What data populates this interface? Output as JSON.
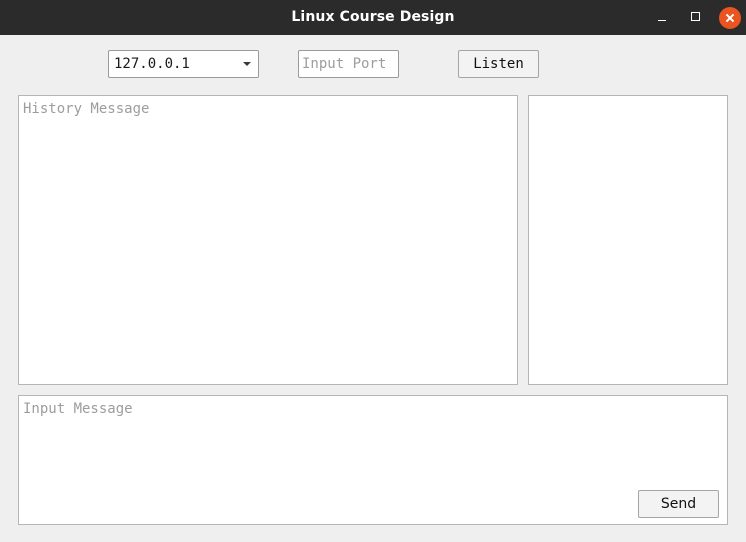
{
  "window": {
    "title": "Linux Course Design",
    "controls": {
      "minimize_icon": "minimize-icon",
      "maximize_icon": "maximize-icon",
      "close_icon": "close-icon",
      "close_color": "#e95420"
    }
  },
  "toolbar": {
    "ip_select": {
      "value": "127.0.0.1"
    },
    "port_input": {
      "value": "",
      "placeholder": "Input Port"
    },
    "listen_label": "Listen"
  },
  "history": {
    "value": "",
    "placeholder": "History Message"
  },
  "clients": {
    "items": []
  },
  "compose": {
    "value": "",
    "placeholder": "Input Message",
    "send_label": "Send"
  },
  "colors": {
    "titlebar": "#2b2b2b",
    "background": "#efefef",
    "accent": "#e95420"
  }
}
